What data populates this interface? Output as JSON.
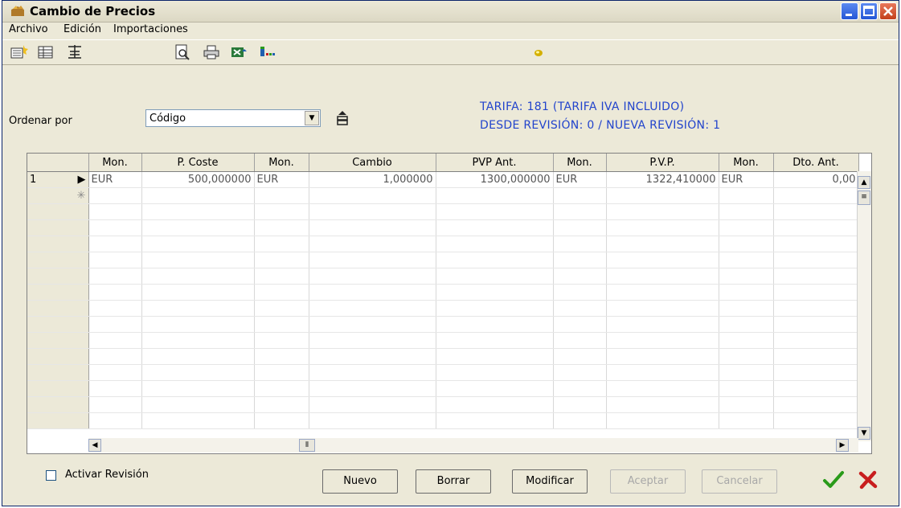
{
  "window": {
    "title": "Cambio de Precios"
  },
  "menu": [
    "Archivo",
    "Edición",
    "Importaciones"
  ],
  "toolbar": {
    "icons": [
      "new-record-icon",
      "grid-view-icon",
      "add-rows-icon",
      "print-preview-icon",
      "print-icon",
      "excel-export-icon",
      "columns-icon",
      "status-led-icon"
    ]
  },
  "filter": {
    "order_label": "Ordenar por",
    "order_value": "Código"
  },
  "info": {
    "tarifa": "TARIFA: 181  (TARIFA IVA INCLUIDO)",
    "revision": "DESDE REVISIÓN: 0  /  NUEVA REVISIÓN: 1"
  },
  "grid": {
    "columns": [
      "",
      "Mon.",
      "P. Coste",
      "Mon.",
      "Cambio",
      "PVP Ant.",
      "Mon.",
      "P.V.P.",
      "Mon.",
      "Dto. Ant."
    ],
    "rows": [
      {
        "index": "1",
        "marker": "▶",
        "cells": [
          "EUR",
          "500,000000",
          "EUR",
          "1,000000",
          "1300,000000",
          "EUR",
          "1322,410000",
          "EUR",
          "0,00"
        ]
      }
    ],
    "new_row_marker": "✳"
  },
  "bottom": {
    "checkbox_label": "Activar Revisión",
    "buttons": {
      "nuevo": "Nuevo",
      "borrar": "Borrar",
      "modificar": "Modificar",
      "aceptar": "Aceptar",
      "cancelar": "Cancelar"
    }
  },
  "colors": {
    "info_text": "#2244cc",
    "accept_check": "#2a9b1a",
    "cancel_x": "#c81e1e"
  }
}
